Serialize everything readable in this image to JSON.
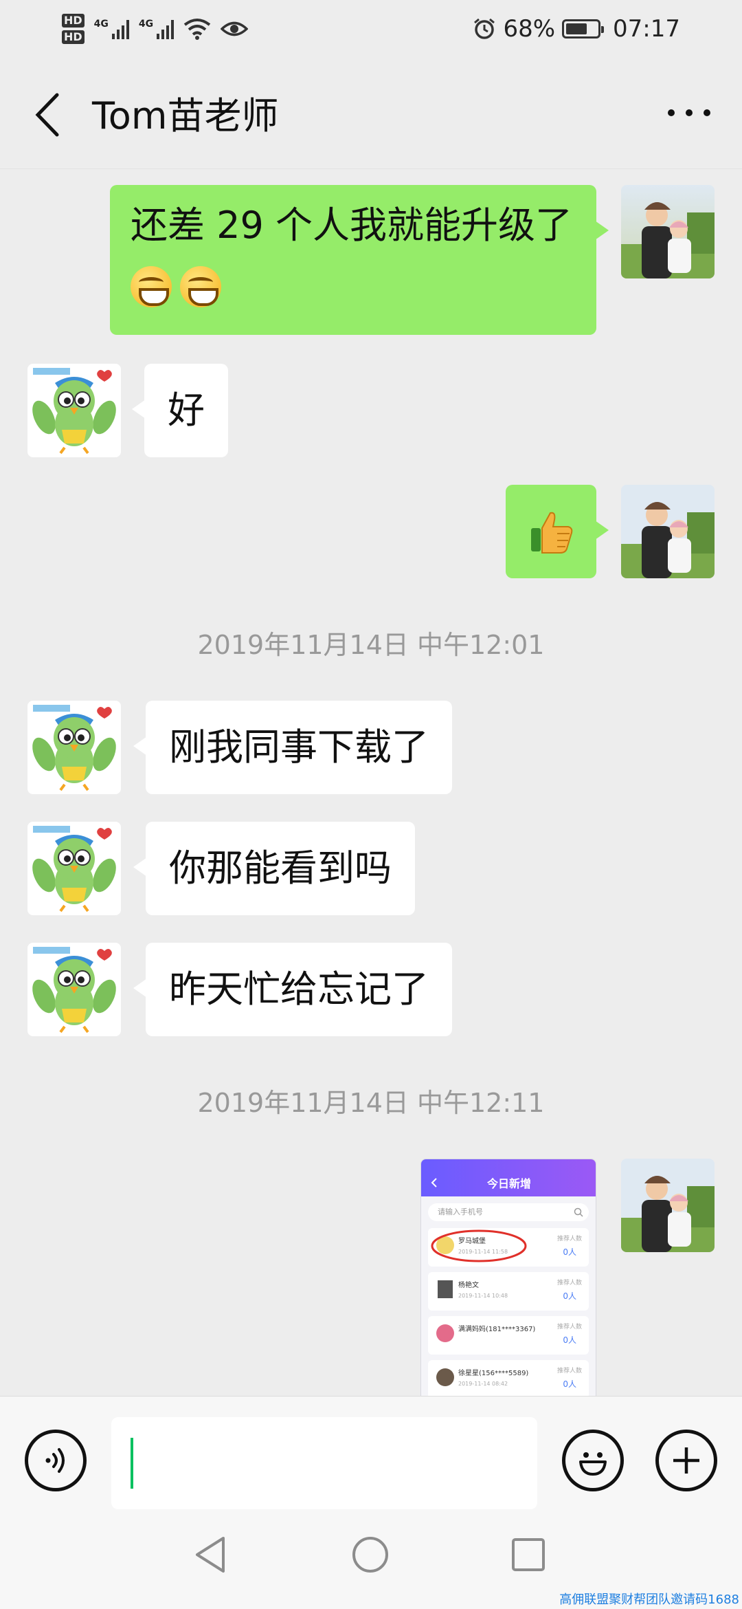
{
  "status_bar": {
    "hd1": "HD",
    "hd2": "HD",
    "net1": "4G",
    "net2": "4G",
    "battery_percent": "68%",
    "battery_level": 0.68,
    "time": "07:17",
    "icons": [
      "signal-icon",
      "wifi-icon",
      "eye-icon",
      "alarm-icon",
      "battery-icon"
    ]
  },
  "header": {
    "title": "Tom苗老师"
  },
  "messages": [
    {
      "side": "right",
      "type": "text",
      "text": "还差 29 个人我就能升级了",
      "emoji_count": 2
    },
    {
      "side": "left",
      "type": "text",
      "text": "好"
    },
    {
      "side": "right",
      "type": "emoji",
      "emoji": "👍"
    },
    {
      "side": "center",
      "type": "timestamp",
      "text": "2019年11月14日 中午12:01"
    },
    {
      "side": "left",
      "type": "text",
      "text": "刚我同事下载了"
    },
    {
      "side": "left",
      "type": "text",
      "text": "你那能看到吗"
    },
    {
      "side": "left",
      "type": "text",
      "text": "昨天忙给忘记了"
    },
    {
      "side": "center",
      "type": "timestamp",
      "text": "2019年11月14日 中午12:11"
    },
    {
      "side": "right",
      "type": "image"
    }
  ],
  "screenshot_image": {
    "title": "今日新增",
    "search_placeholder": "请输入手机号",
    "rows": [
      {
        "name": "罗马城堡",
        "time": "2019-11-14 11:58",
        "label": "推荐人数",
        "count": "0人"
      },
      {
        "name": "杨艳文",
        "time": "2019-11-14 10:48",
        "label": "推荐人数",
        "count": "0人"
      },
      {
        "name": "满满妈妈(181****3367)",
        "time": "",
        "label": "推荐人数",
        "count": "0人"
      },
      {
        "name": "徐星星(156****5589)",
        "time": "2019-11-14 08:42",
        "label": "推荐人数",
        "count": "0人"
      }
    ]
  },
  "input": {
    "value": ""
  },
  "watermark": "高佣联盟聚财帮团队邀请码1688",
  "colors": {
    "background": "#ededed",
    "sent_bubble": "#95ec69",
    "received_bubble": "#ffffff",
    "caret": "#07c160"
  }
}
